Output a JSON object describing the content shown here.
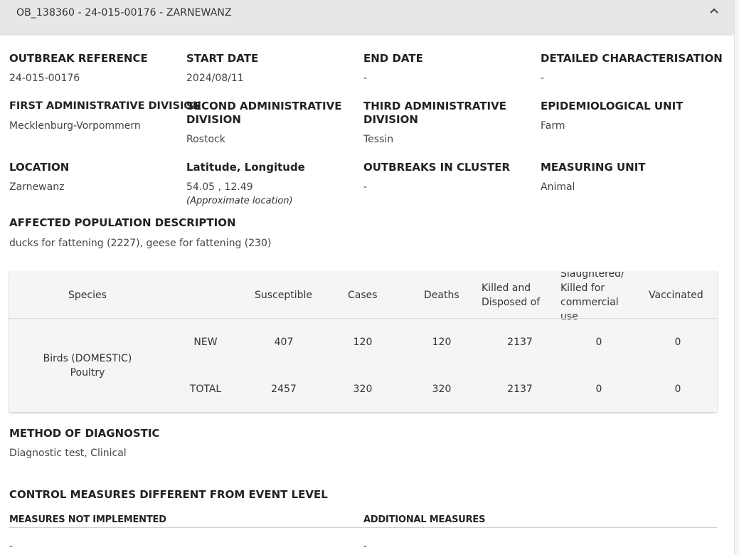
{
  "header": {
    "title": "OB_138360 - 24-015-00176 - ZARNEWANZ"
  },
  "fields": {
    "outbreak_reference": {
      "label": "OUTBREAK REFERENCE",
      "value": "24-015-00176"
    },
    "start_date": {
      "label": "START DATE",
      "value": "2024/08/11"
    },
    "end_date": {
      "label": "END DATE",
      "value": "-"
    },
    "detailed_characterisation": {
      "label": "DETAILED CHARACTERISATION",
      "value": "-"
    },
    "first_admin_division": {
      "label": "FIRST ADMINISTRATIVE DIVISION",
      "value": "Mecklenburg-Vorpommern"
    },
    "second_admin_division": {
      "label_line1": "SECOND ADMINISTRATIVE",
      "label_line2": "DIVISION",
      "value": "Rostock"
    },
    "third_admin_division": {
      "label_line1": "THIRD ADMINISTRATIVE",
      "label_line2": "DIVISION",
      "value": "Tessin"
    },
    "epidemiological_unit": {
      "label": "EPIDEMIOLOGICAL UNIT",
      "value": "Farm"
    },
    "location": {
      "label": "LOCATION",
      "value": "Zarnewanz"
    },
    "lat_long": {
      "label": "Latitude, Longitude",
      "value": "54.05 , 12.49",
      "note": "(Approximate location)"
    },
    "outbreaks_in_cluster": {
      "label": "OUTBREAKS IN CLUSTER",
      "value": "-"
    },
    "measuring_unit": {
      "label": "MEASURING UNIT",
      "value": "Animal"
    },
    "affected_population": {
      "label": "AFFECTED POPULATION DESCRIPTION",
      "value": "ducks for fattening (2227), geese for fattening (230)"
    }
  },
  "table": {
    "headers": {
      "species": "Species",
      "susceptible": "Susceptible",
      "cases": "Cases",
      "deaths": "Deaths",
      "killed_line1": "Killed and",
      "killed_line2": "Disposed of",
      "slaughtered_line0": "Slaughtered/",
      "slaughtered_line1": "Killed for",
      "slaughtered_line2": "commercial",
      "slaughtered_line3": "use",
      "vaccinated": "Vaccinated"
    },
    "species_line1": "Birds (DOMESTIC)",
    "species_line2": "Poultry",
    "rows": [
      {
        "type": "NEW",
        "susceptible": "407",
        "cases": "120",
        "deaths": "120",
        "killed": "2137",
        "slaughtered": "0",
        "vaccinated": "0"
      },
      {
        "type": "TOTAL",
        "susceptible": "2457",
        "cases": "320",
        "deaths": "320",
        "killed": "2137",
        "slaughtered": "0",
        "vaccinated": "0"
      }
    ]
  },
  "diagnostic": {
    "label": "METHOD OF DIAGNOSTIC",
    "value": "Diagnostic test, Clinical"
  },
  "control": {
    "title": "CONTROL MEASURES DIFFERENT FROM EVENT LEVEL",
    "not_implemented_label": "MEASURES NOT IMPLEMENTED",
    "additional_label": "ADDITIONAL MEASURES",
    "not_implemented_value": "-",
    "additional_value": "-"
  }
}
